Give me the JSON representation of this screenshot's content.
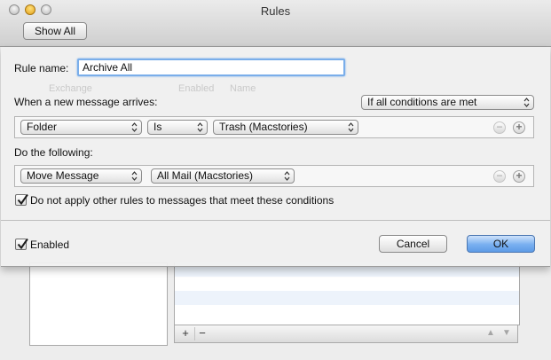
{
  "window": {
    "title": "Rules",
    "toolbar_button": "Show All"
  },
  "background": {
    "ghost_account": "Exchange",
    "ghost_col_enabled": "Enabled",
    "ghost_col_name": "Name",
    "add_label": "+",
    "remove_label": "−",
    "up_label": "▲",
    "down_label": "▼"
  },
  "sheet": {
    "rule_name_label": "Rule name:",
    "rule_name_value": "Archive All",
    "when_label": "When a new message arrives:",
    "match_popup": "If all conditions are met",
    "condition": {
      "field": "Folder",
      "operator": "Is",
      "value": "Trash (Macstories)"
    },
    "do_label": "Do the following:",
    "action": {
      "action": "Move Message",
      "target": "All Mail (Macstories)"
    },
    "stop_rules_label": "Do not apply other rules to messages that meet these conditions",
    "stop_rules_checked": true,
    "enabled_label": "Enabled",
    "enabled_checked": true,
    "remove_label": "−",
    "add_label": "+",
    "cancel_label": "Cancel",
    "ok_label": "OK"
  },
  "colors": {
    "accent": "#5d9be6",
    "focus_ring": "#7aaeea"
  }
}
